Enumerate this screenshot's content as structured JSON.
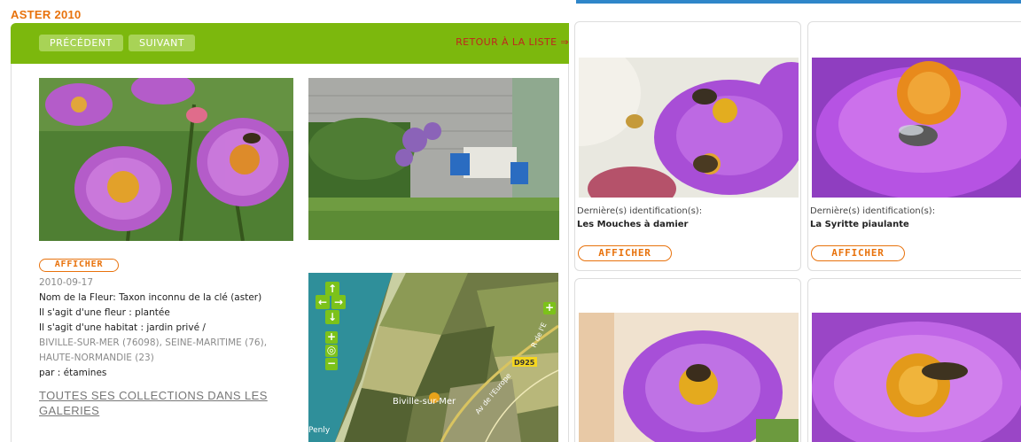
{
  "page_title": "ASTER 2010",
  "nav": {
    "prev_label": "PRÉCÉDENT",
    "next_label": "SUIVANT",
    "back_label": "RETOUR À LA LISTE ⇒"
  },
  "main": {
    "afficher_label": "AFFICHER",
    "date": "2010-09-17",
    "flower_line": "Nom de la Fleur: Taxon inconnu de la clé (aster)",
    "flower_type_line": "Il s'agit d'une fleur : plantée",
    "habitat_line": "Il s'agit d'une habitat : jardin privé /",
    "location_line1": "BIVILLE-SUR-MER (76098), SEINE-MARITIME (76),",
    "location_line2": "HAUTE-NORMANDIE (23)",
    "by_line": "par : étamines",
    "collections_link": "TOUTES SES COLLECTIONS DANS LES GALERIES"
  },
  "map": {
    "town_label": "Biville-sur-Mer",
    "road_label": "D925",
    "street_label1": "Av de l'Europe",
    "street_label2": "R de l'E",
    "place_label": "Penly"
  },
  "cards": [
    {
      "caption_label": "Dernière(s) identification(s):",
      "name": "Les Mouches à damier",
      "button": "AFFICHER"
    },
    {
      "caption_label": "Dernière(s) identification(s):",
      "name": "La Syritte piaulante",
      "button": "AFFICHER"
    },
    {
      "caption_label": "",
      "name": "",
      "button": ""
    },
    {
      "caption_label": "",
      "name": "",
      "button": ""
    }
  ],
  "colors": {
    "accent_orange": "#e8720c",
    "nav_green": "#7cb80d",
    "link_red": "#c0261d",
    "top_blue": "#2f86c9"
  }
}
